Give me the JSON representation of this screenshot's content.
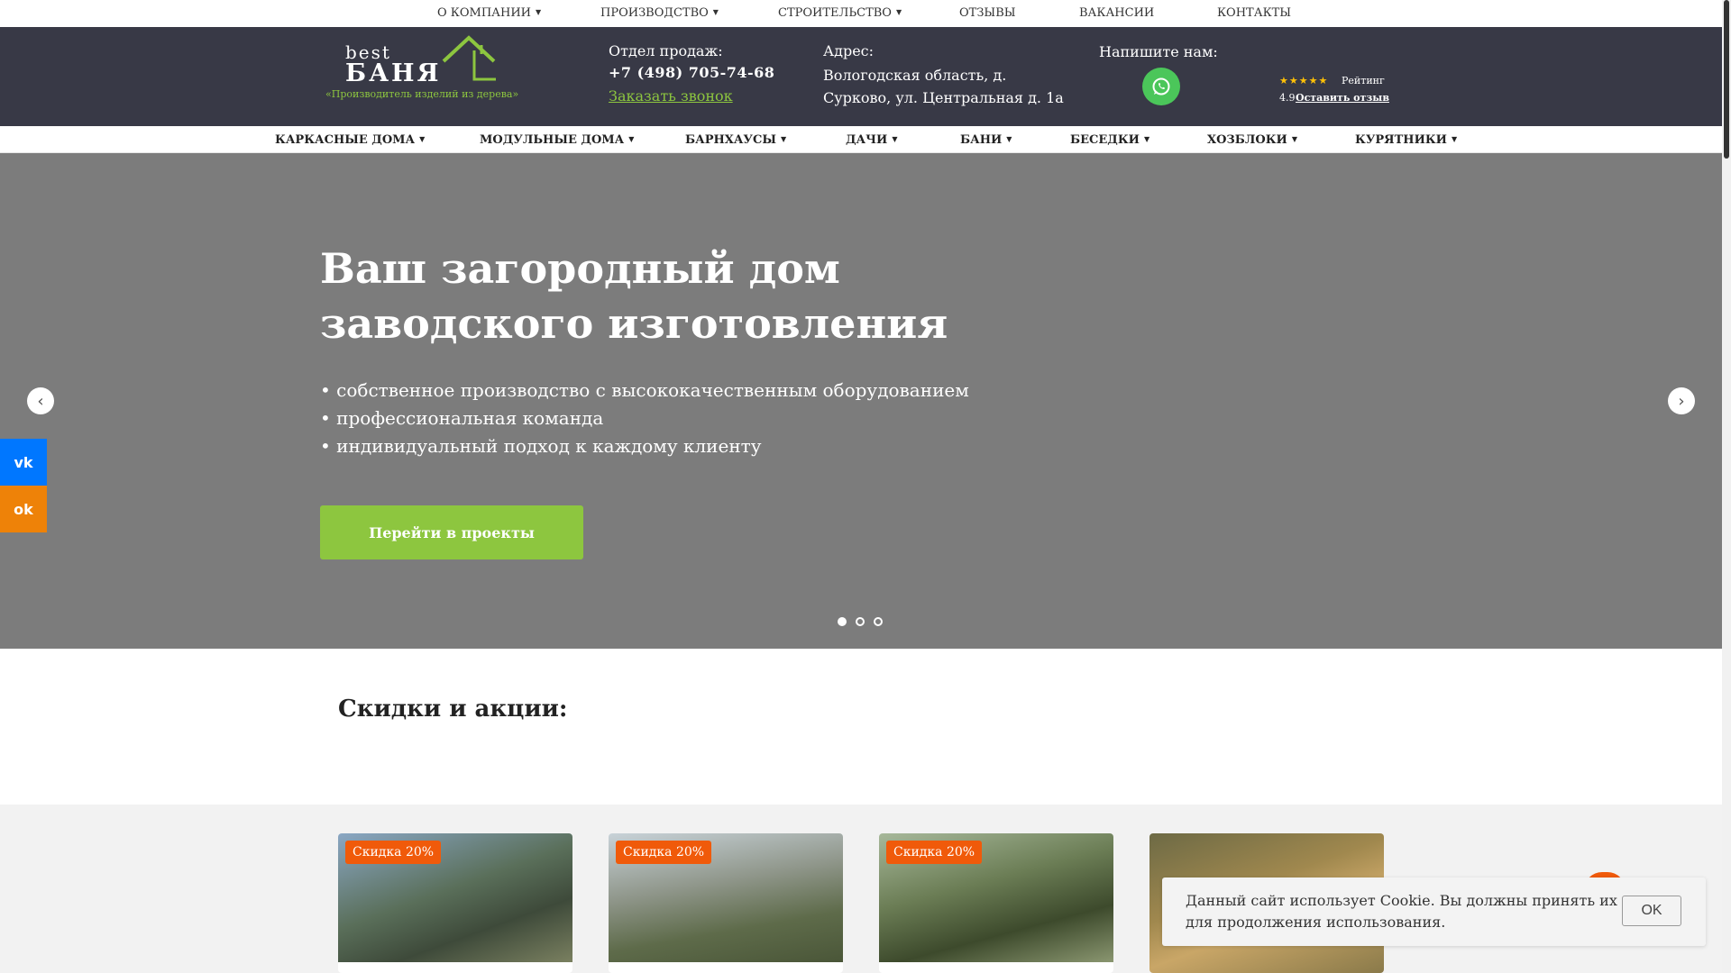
{
  "topnav": {
    "items": [
      {
        "label": "О КОМПАНИИ",
        "dropdown": true
      },
      {
        "label": "ПРОИЗВОДСТВО",
        "dropdown": true
      },
      {
        "label": "СТРОИТЕЛЬСТВО",
        "dropdown": true
      },
      {
        "label": "ОТЗЫВЫ",
        "dropdown": false
      },
      {
        "label": "ВАКАНСИИ",
        "dropdown": false
      },
      {
        "label": "КОНТАКТЫ",
        "dropdown": false
      }
    ]
  },
  "header": {
    "logo_best": "best",
    "logo_banya": "БАНЯ",
    "logo_tagline": "«Производитель изделий из дерева»",
    "sales_label": "Отдел продаж:",
    "phone": "+7 (498) 705-74-68",
    "callback": "Заказать звонок",
    "address_label": "Адрес:",
    "address": "Вологодская область, д. Сурково, ул. Центральная д. 1а",
    "write_label": "Напишите нам:",
    "rating_stars": "★★★★★",
    "rating_label": "Рейтинг",
    "rating_value": "4.9",
    "review_link": "Оставить отзыв"
  },
  "mainmenu": {
    "items": [
      {
        "label": "КАРКАСНЫЕ ДОМА"
      },
      {
        "label": "МОДУЛЬНЫЕ ДОМА"
      },
      {
        "label": "БАРНХАУСЫ"
      },
      {
        "label": "ДАЧИ"
      },
      {
        "label": "БАНИ"
      },
      {
        "label": "БЕСЕДКИ"
      },
      {
        "label": "ХОЗБЛОКИ"
      },
      {
        "label": "КУРЯТНИКИ"
      }
    ],
    "caret": "▼"
  },
  "hero": {
    "title": "Ваш загородный дом заводского изготовления",
    "bullets": [
      "• собственное производство с высококачественным оборудованием",
      "• профессиональная команда",
      "• индивидуальный подход к каждому клиенту"
    ],
    "cta": "Перейти в проекты",
    "active_slide": 1,
    "slide_count": 3
  },
  "social": {
    "vk": "vk",
    "ok": "ok"
  },
  "discounts": {
    "title": "Скидки и акции:",
    "cards": [
      {
        "badge": "Скидка 20%"
      },
      {
        "badge": "Скидка 20%"
      },
      {
        "badge": "Скидка 20%"
      },
      {
        "badge": ""
      }
    ]
  },
  "cookie": {
    "text": "Данный сайт использует Cookie. Вы должны принять их для продолжения использования.",
    "button": "OK"
  },
  "colors": {
    "header_bg": "#383946",
    "accent_green": "#8dc63f",
    "hero_bg": "#7c7c7c",
    "badge_orange": "#f05a0a",
    "vk_blue": "#0077ff",
    "ok_orange": "#ee8208"
  }
}
